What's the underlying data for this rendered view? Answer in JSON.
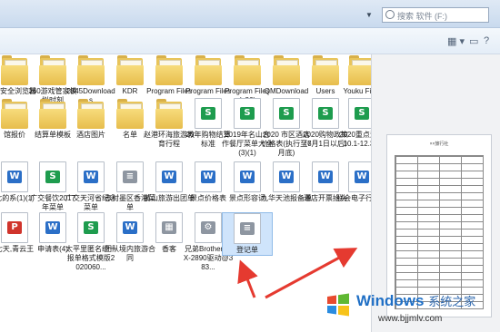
{
  "search": {
    "placeholder": "搜索 软件 (F:)"
  },
  "items": [
    {
      "label": "中安全浏览器",
      "type": "folder",
      "partial": true
    },
    {
      "label": "360游戏管家模拟时刻",
      "type": "folder"
    },
    {
      "label": "2345Downloads",
      "type": "folder"
    },
    {
      "label": "KDR",
      "type": "folder"
    },
    {
      "label": "Program Files",
      "type": "folder"
    },
    {
      "label": "Program Files",
      "type": "folder"
    },
    {
      "label": "Program Files (x86)",
      "type": "folder"
    },
    {
      "label": "QMDownload",
      "type": "folder"
    },
    {
      "label": "Users",
      "type": "folder"
    },
    {
      "label": "Youku Files",
      "type": "folder"
    },
    {
      "label": "馆报价",
      "type": "folder",
      "partial": true
    },
    {
      "label": "结算单模板",
      "type": "folder"
    },
    {
      "label": "酒店图片",
      "type": "folder"
    },
    {
      "label": "名单",
      "type": "folder"
    },
    {
      "label": "赵港环海旅游教育行程",
      "type": "folder"
    },
    {
      "label": "20年购物结算标准",
      "type": "excel"
    },
    {
      "label": "2019年名山合作餐厅菜单大全(3)(1)",
      "type": "excel"
    },
    {
      "label": "2020 市区酒店价格表(执行至6月底)",
      "type": "excel"
    },
    {
      "label": "2020购物政策（7月1日以后）",
      "type": "excel"
    },
    {
      "label": "2020重点汇总 10.1-12.31)",
      "type": "excel"
    },
    {
      "label": "七的系(1)(1)",
      "type": "word",
      "partial": true
    },
    {
      "label": "广交餐饮2017年菜单",
      "type": "excel"
    },
    {
      "label": "广交天河省纪念菜单",
      "type": "word"
    },
    {
      "label": "赤村墨区香港菜单",
      "type": "doc"
    },
    {
      "label": "黄山旅游出团单",
      "type": "word"
    },
    {
      "label": "景点价格表",
      "type": "word"
    },
    {
      "label": "景点形容词",
      "type": "word"
    },
    {
      "label": "九华天池报备单",
      "type": "word"
    },
    {
      "label": "酒店开票抬头",
      "type": "word"
    },
    {
      "label": "联会电子行程单",
      "type": "word"
    },
    {
      "label": "七天,青云王",
      "type": "red",
      "partial": true
    },
    {
      "label": "申请表(4)",
      "type": "word"
    },
    {
      "label": "太平里匿名统一报单格式模版2020060...",
      "type": "excel"
    },
    {
      "label": "团队境内旅游合同",
      "type": "word"
    },
    {
      "label": "香客",
      "type": "image"
    },
    {
      "label": "兄弟BrotherFAX-2890驱动@383...",
      "type": "driver"
    },
    {
      "label": "登记单",
      "type": "doc",
      "selected": true
    }
  ],
  "preview": {
    "title": "××旅行社"
  },
  "watermark": {
    "brand": "Windows",
    "brand_cn": "系统之家",
    "url": "www.bjjmlv.com"
  },
  "colors": {
    "arrow": "#e53a30",
    "link": "#1f6fc5"
  }
}
